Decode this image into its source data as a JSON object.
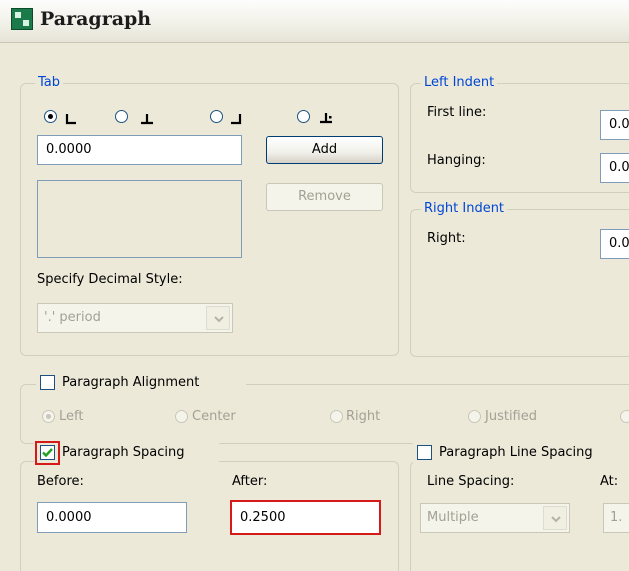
{
  "window": {
    "title": "Paragraph",
    "icon": "paragraph-app-icon"
  },
  "tab": {
    "group_title": "Tab",
    "stops": [
      {
        "name": "left-tab",
        "selected": true
      },
      {
        "name": "center-tab",
        "selected": false
      },
      {
        "name": "right-tab",
        "selected": false
      },
      {
        "name": "decimal-tab",
        "selected": false
      }
    ],
    "position_value": "0.0000",
    "add_label": "Add",
    "remove_label": "Remove",
    "decimal_style_label": "Specify Decimal Style:",
    "decimal_style_value": "'.' period"
  },
  "left_indent": {
    "group_title": "Left Indent",
    "first_line_label": "First line:",
    "first_line_value": "0.0",
    "hanging_label": "Hanging:",
    "hanging_value": "0.0"
  },
  "right_indent": {
    "group_title": "Right Indent",
    "right_label": "Right:",
    "right_value": "0.0"
  },
  "alignment": {
    "checkbox_label": "Paragraph Alignment",
    "checked": false,
    "options": [
      "Left",
      "Center",
      "Right",
      "Justified"
    ],
    "selected": "Left"
  },
  "spacing": {
    "checkbox_label": "Paragraph Spacing",
    "checked": true,
    "before_label": "Before:",
    "before_value": "0.0000",
    "after_label": "After:",
    "after_value": "0.2500"
  },
  "line_spacing": {
    "checkbox_label": "Paragraph Line Spacing",
    "checked": false,
    "line_spacing_label": "Line Spacing:",
    "line_spacing_value": "Multiple",
    "at_label": "At:",
    "at_value": "1."
  },
  "colors": {
    "group_title": "#0046d5",
    "highlight": "#d61a1a",
    "check": "#21a121"
  }
}
